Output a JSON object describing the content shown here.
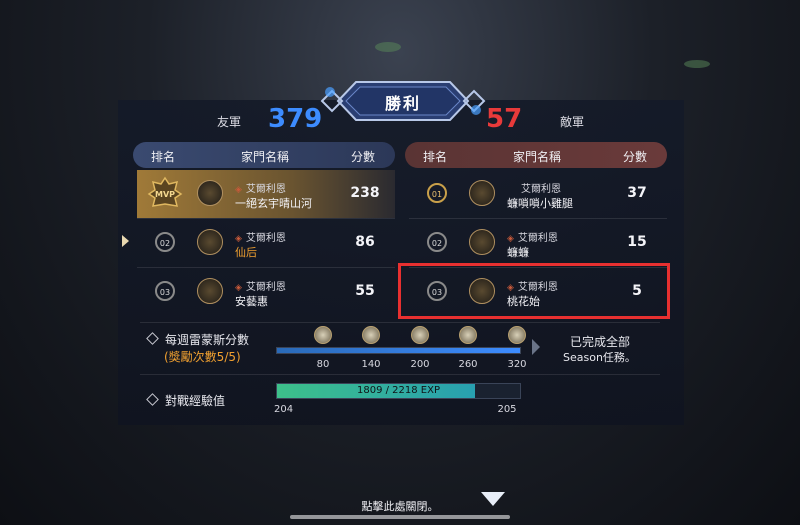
{
  "header": {
    "result": "勝利",
    "ally_label": "友軍",
    "ally_score": "379",
    "enemy_label": "敵軍",
    "enemy_score": "57"
  },
  "columns": {
    "rank": "排名",
    "family": "家門名稱",
    "score": "分數"
  },
  "ally_rows": [
    {
      "rank": "MVP",
      "server": "艾爾利恩",
      "family": "一絕玄宇晴山河",
      "score": "238",
      "family_color": "#f4f4f8"
    },
    {
      "rank": "02",
      "server": "艾爾利恩",
      "family": "仙后",
      "score": "86",
      "family_color": "#f0a030"
    },
    {
      "rank": "03",
      "server": "艾爾利恩",
      "family": "安藝惠",
      "score": "55",
      "family_color": "#f4f4f8"
    }
  ],
  "enemy_rows": [
    {
      "rank": "01",
      "server": "艾爾利恩",
      "family": "蠊嗩嗩小雞腿",
      "score": "37"
    },
    {
      "rank": "02",
      "server": "艾爾利恩",
      "family": "蠊蠊",
      "score": "15"
    },
    {
      "rank": "03",
      "server": "艾爾利恩",
      "family": "桃花始",
      "score": "5"
    }
  ],
  "weekly": {
    "label": "每週雷蒙斯分數",
    "sub_label": "(獎勵次數5/5)",
    "ticks": [
      "80",
      "140",
      "200",
      "260",
      "320"
    ],
    "progress": 1.0,
    "complete_line1": "已完成全部",
    "complete_line2": "Season任務。"
  },
  "exp": {
    "label": "對戰經驗值",
    "text": "1809 / 2218 EXP",
    "current": 1809,
    "max": 2218,
    "level_from": "204",
    "level_to": "205"
  },
  "footer": {
    "close_text": "點擊此處關閉。"
  },
  "colors": {
    "ally": "#3d8cff",
    "enemy": "#e83a3a",
    "highlight": "#e83030",
    "exp_bar": "#3dc08a"
  }
}
